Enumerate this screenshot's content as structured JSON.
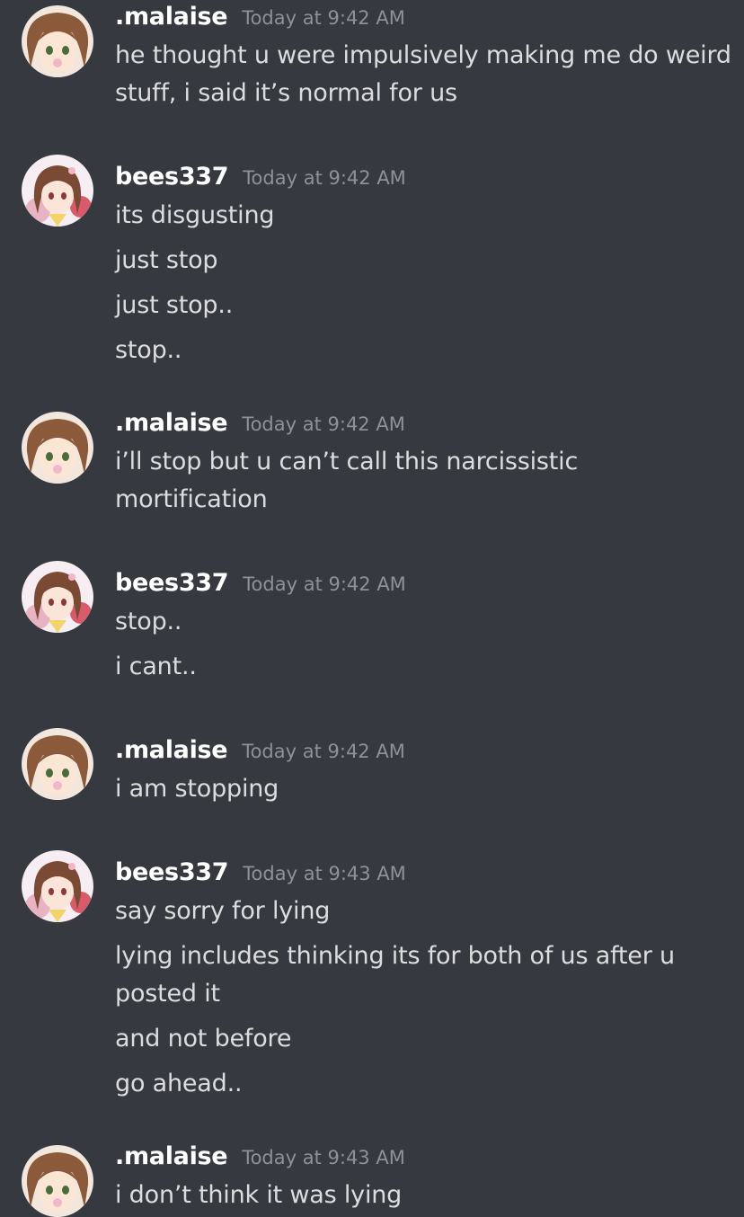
{
  "colors": {
    "background": "#36393f",
    "username": "#ffffff",
    "timestamp": "#8e9297",
    "text": "#dcddde"
  },
  "messages": [
    {
      "username": ".malaise",
      "timestamp": "Today at 9:42 AM",
      "avatar": "malaise-avatar",
      "lines": [
        "he thought u were impulsively making me do weird stuff, i said it’s normal for us"
      ]
    },
    {
      "username": "bees337",
      "timestamp": "Today at 9:42 AM",
      "avatar": "bees337-avatar",
      "lines": [
        "its disgusting",
        "just stop",
        "just stop..",
        "stop.."
      ]
    },
    {
      "username": ".malaise",
      "timestamp": "Today at 9:42 AM",
      "avatar": "malaise-avatar",
      "lines": [
        "i’ll stop but u can’t call this narcissistic mortification"
      ]
    },
    {
      "username": "bees337",
      "timestamp": "Today at 9:42 AM",
      "avatar": "bees337-avatar",
      "lines": [
        "stop..",
        "i cant.."
      ]
    },
    {
      "username": ".malaise",
      "timestamp": "Today at 9:42 AM",
      "avatar": "malaise-avatar",
      "lines": [
        "i am stopping"
      ]
    },
    {
      "username": "bees337",
      "timestamp": "Today at 9:43 AM",
      "avatar": "bees337-avatar",
      "lines": [
        "say sorry for lying",
        "lying includes thinking its for both of us after u posted it",
        "and not before",
        "go ahead.."
      ]
    },
    {
      "username": ".malaise",
      "timestamp": "Today at 9:43 AM",
      "avatar": "malaise-avatar",
      "lines": [
        "i don’t think it was lying"
      ]
    }
  ]
}
